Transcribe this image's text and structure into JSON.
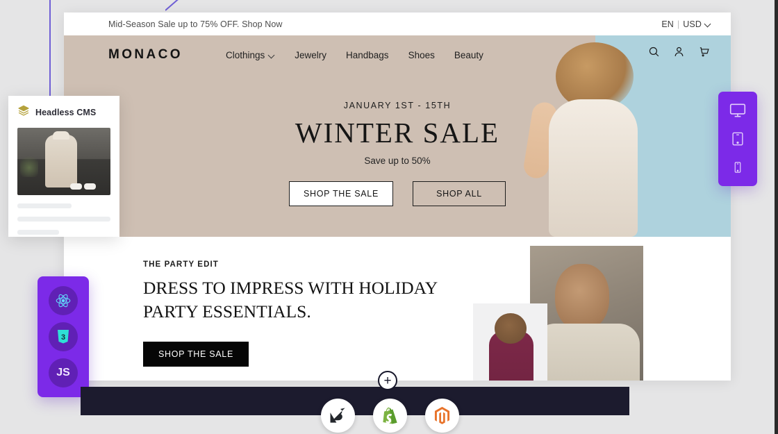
{
  "announcement": {
    "text": "Mid-Season Sale up to 75% OFF. Shop Now",
    "language": "EN",
    "separator": "|",
    "currency": "USD"
  },
  "header": {
    "brand": "MONACO",
    "nav": [
      {
        "label": "Clothings",
        "has_dropdown": true
      },
      {
        "label": "Jewelry",
        "has_dropdown": false
      },
      {
        "label": "Handbags",
        "has_dropdown": false
      },
      {
        "label": "Shoes",
        "has_dropdown": false
      },
      {
        "label": "Beauty",
        "has_dropdown": false
      }
    ],
    "icons": [
      "search-icon",
      "account-icon",
      "cart-icon"
    ]
  },
  "hero": {
    "kicker": "JANUARY 1ST - 15TH",
    "title": "WINTER SALE",
    "subtitle": "Save up to 50%",
    "primary_cta": "SHOP THE SALE",
    "secondary_cta": "SHOP ALL",
    "bg_color": "#cebfb3",
    "accent_panel_color": "#aed2dd"
  },
  "section_two": {
    "eyebrow": "THE PARTY EDIT",
    "headline": "DRESS TO IMPRESS WITH HOLIDAY PARTY ESSENTIALS.",
    "cta": "SHOP THE SALE"
  },
  "cms_card": {
    "title": "Headless CMS",
    "icon": "layers-icon",
    "icon_color": "#b5a23c"
  },
  "tech_badge": {
    "color": "#7c2ae8",
    "items": [
      {
        "name": "react-icon",
        "label": "React"
      },
      {
        "name": "css3-icon",
        "label": "3"
      },
      {
        "name": "javascript-icon",
        "label": "JS"
      }
    ]
  },
  "device_switcher": {
    "color": "#7c2ae8",
    "items": [
      {
        "name": "desktop-icon",
        "label": "Desktop"
      },
      {
        "name": "tablet-icon",
        "label": "Tablet"
      },
      {
        "name": "mobile-icon",
        "label": "Mobile"
      }
    ]
  },
  "platform_bar": {
    "bg_color": "#1c1b2e",
    "add_label": "+",
    "platforms": [
      {
        "name": "bigcommerce-icon",
        "label": "BigCommerce"
      },
      {
        "name": "shopify-icon",
        "label": "Shopify"
      },
      {
        "name": "magento-icon",
        "label": "Magento"
      }
    ]
  }
}
